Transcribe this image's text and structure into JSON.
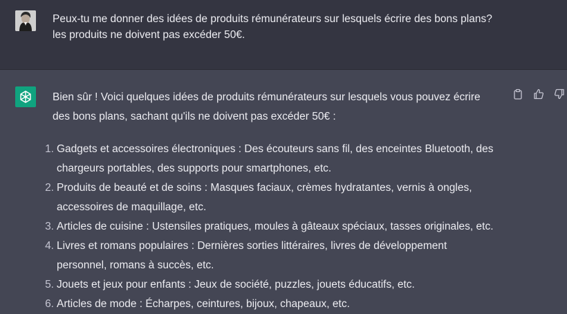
{
  "user_message": {
    "line1": "Peux-tu me donner des idées de produits rémunérateurs sur lesquels écrire des bons plans?",
    "line2": "les produits ne doivent pas excéder 50€."
  },
  "assistant_message": {
    "intro_line1": "Bien sûr ! Voici quelques idées de produits rémunérateurs sur lesquels vous pouvez écrire",
    "intro_line2": "des bons plans, sachant qu'ils ne doivent pas excéder 50€ :",
    "items": [
      {
        "num": "1.",
        "line1": "Gadgets et accessoires électroniques : Des écouteurs sans fil, des enceintes Bluetooth, des",
        "line2": "chargeurs portables, des supports pour smartphones, etc."
      },
      {
        "num": "2.",
        "line1": "Produits de beauté et de soins : Masques faciaux, crèmes hydratantes, vernis à ongles,",
        "line2": "accessoires de maquillage, etc."
      },
      {
        "num": "3.",
        "line1": "Articles de cuisine : Ustensiles pratiques, moules à gâteaux spéciaux, tasses originales, etc.",
        "line2": ""
      },
      {
        "num": "4.",
        "line1": "Livres et romans populaires : Dernières sorties littéraires, livres de développement",
        "line2": "personnel, romans à succès, etc."
      },
      {
        "num": "5.",
        "line1": "Jouets et jeux pour enfants : Jeux de société, puzzles, jouets éducatifs, etc.",
        "line2": ""
      },
      {
        "num": "6.",
        "line1": "Articles de mode : Écharpes, ceintures, bijoux, chapeaux, etc.",
        "line2": ""
      }
    ]
  },
  "icons": {
    "user_avatar": "user-photo-avatar",
    "bot_avatar": "openai-logo-icon",
    "copy": "clipboard-icon",
    "thumbs_up": "thumbs-up-icon",
    "thumbs_down": "thumbs-down-icon"
  },
  "colors": {
    "user_bg": "#343541",
    "assistant_bg": "#444654",
    "bot_avatar_bg": "#10a37f",
    "text": "#ececf1"
  }
}
